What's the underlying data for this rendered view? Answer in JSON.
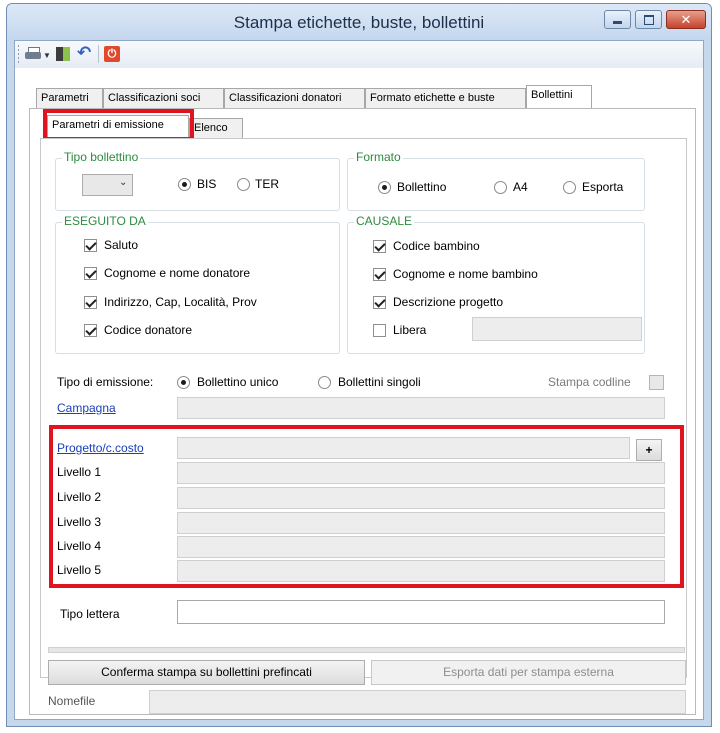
{
  "window": {
    "title": "Stampa etichette, buste, bollettini"
  },
  "main_tabs": [
    "Parametri",
    "Classificazioni soci",
    "Classificazioni donatori",
    "Formato etichette e buste",
    "Bollettini"
  ],
  "sub_tabs": [
    "Parametri di emissione",
    "Elenco"
  ],
  "tipo_bollettino": {
    "label": "Tipo bollettino",
    "select_value": "",
    "options": [
      "BIS",
      "TER"
    ],
    "selected": "BIS"
  },
  "formato": {
    "label": "Formato",
    "options": [
      "Bollettino",
      "A4",
      "Esporta"
    ],
    "selected": "Bollettino"
  },
  "eseguito_da": {
    "label": "ESEGUITO DA",
    "items": [
      {
        "label": "Saluto",
        "checked": true
      },
      {
        "label": "Cognome e nome donatore",
        "checked": true
      },
      {
        "label": "Indirizzo, Cap, Località, Prov",
        "checked": true
      },
      {
        "label": "Codice donatore",
        "checked": true
      }
    ]
  },
  "causale": {
    "label": "CAUSALE",
    "items": [
      {
        "label": "Codice bambino",
        "checked": true
      },
      {
        "label": "Cognome e nome bambino",
        "checked": true
      },
      {
        "label": "Descrizione progetto",
        "checked": true
      },
      {
        "label": "Libera",
        "checked": false
      }
    ],
    "libera_value": ""
  },
  "emissione": {
    "label": "Tipo di emissione:",
    "options": [
      "Bollettino unico",
      "Bollettini singoli"
    ],
    "selected": "Bollettino unico",
    "codline_label": "Stampa codline",
    "codline_checked": false
  },
  "campagna": {
    "label": "Campagna",
    "value": ""
  },
  "progetto": {
    "label": "Progetto/c.costo",
    "value": "",
    "add_label": "+"
  },
  "livelli": [
    {
      "label": "Livello 1",
      "value": ""
    },
    {
      "label": "Livello 2",
      "value": ""
    },
    {
      "label": "Livello 3",
      "value": ""
    },
    {
      "label": "Livello 4",
      "value": ""
    },
    {
      "label": "Livello 5",
      "value": ""
    }
  ],
  "tipo_lettera": {
    "label": "Tipo lettera",
    "value": ""
  },
  "buttons": {
    "conferma": "Conferma stampa su bollettini prefincati",
    "esporta": "Esporta dati per stampa esterna"
  },
  "nomefile": {
    "label": "Nomefile",
    "value": ""
  },
  "colors": {
    "highlight": "#e0141e",
    "group_label": "#2e8b3f",
    "link": "#1a3fb8"
  }
}
